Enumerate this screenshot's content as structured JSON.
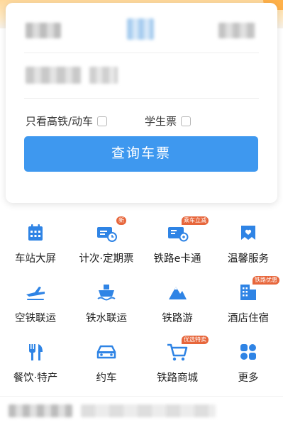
{
  "options": {
    "high_speed_label": "只看高铁/动车",
    "student_label": "学生票"
  },
  "search_button_label": "查询车票",
  "services": [
    {
      "label": "车站大屏",
      "icon": "calendar-icon",
      "badge": ""
    },
    {
      "label": "计次·定期票",
      "icon": "ticket-clock-icon",
      "badge": "新"
    },
    {
      "label": "铁路e卡通",
      "icon": "id-card-icon",
      "badge": "乘车立减"
    },
    {
      "label": "温馨服务",
      "icon": "heart-banner-icon",
      "badge": ""
    },
    {
      "label": "空铁联运",
      "icon": "airplane-icon",
      "badge": ""
    },
    {
      "label": "铁水联运",
      "icon": "ship-icon",
      "badge": ""
    },
    {
      "label": "铁路游",
      "icon": "mountain-icon",
      "badge": ""
    },
    {
      "label": "酒店住宿",
      "icon": "hotel-icon",
      "badge": "铁路优惠"
    },
    {
      "label": "餐饮·特产",
      "icon": "fork-knife-icon",
      "badge": ""
    },
    {
      "label": "约车",
      "icon": "car-icon",
      "badge": ""
    },
    {
      "label": "铁路商城",
      "icon": "shopping-cart-icon",
      "badge": "优选特卖"
    },
    {
      "label": "更多",
      "icon": "more-grid-icon",
      "badge": ""
    }
  ],
  "colors": {
    "accent": "#3e98ef",
    "icon_blue": "#2f84e5",
    "badge": "#e7663b"
  }
}
